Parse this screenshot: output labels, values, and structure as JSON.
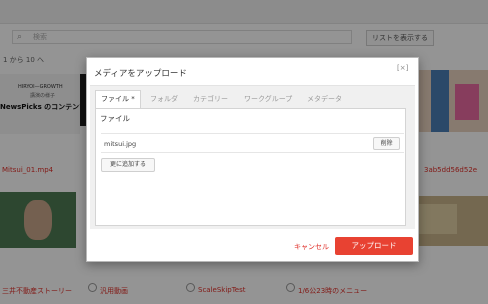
{
  "background": {
    "search_placeholder": "検索",
    "list_button": "リストを表示する",
    "pager": "1 から 10 へ",
    "thumb1": {
      "line1": "HIRYOI—GROWTH",
      "line2": "講演の様子",
      "line3": "NewsPicks のコンテンツ戦略"
    },
    "files": {
      "left_1": "Mitsui_01.mp4",
      "right_1": "3ab5dd56d52e"
    },
    "bottom_items": [
      "三井不動産ストーリー",
      "汎用動画",
      "ScaleSkipTest",
      "1/6公23時のメニュー"
    ]
  },
  "modal": {
    "title": "メディアをアップロード",
    "close_label": "[×]",
    "tabs": [
      {
        "label": "ファイル *",
        "active": true
      },
      {
        "label": "フォルダ",
        "active": false
      },
      {
        "label": "カテゴリー",
        "active": false
      },
      {
        "label": "ワークグループ",
        "active": false
      },
      {
        "label": "メタデータ",
        "active": false
      }
    ],
    "panel_label": "ファイル",
    "file_name": "mitsui.jpg",
    "delete_label": "削除",
    "add_more_label": "更に追加する",
    "cancel_label": "キャンセル",
    "upload_label": "アップロード"
  },
  "colors": {
    "accent": "#e84232",
    "link": "#e0302a"
  }
}
